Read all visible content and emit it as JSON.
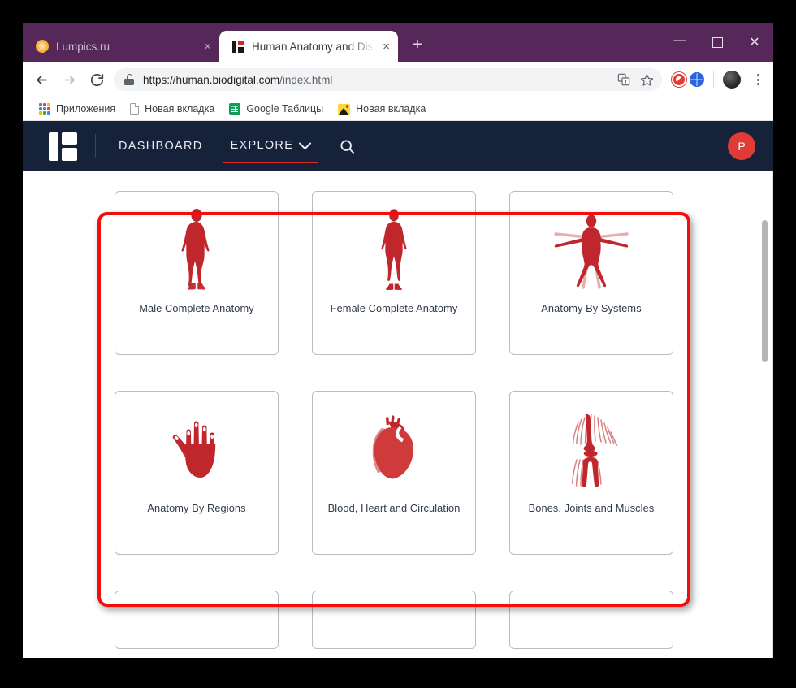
{
  "browser": {
    "tabs": [
      {
        "title": "Lumpics.ru",
        "favicon": "orange-slice-icon",
        "active": false,
        "close_label": "×"
      },
      {
        "title": "Human Anatomy and Disease in",
        "favicon": "biodigital-favicon",
        "active": true,
        "close_label": "×"
      }
    ],
    "new_tab_label": "+",
    "window_controls": {
      "minimize": "—",
      "maximize": "",
      "close": "✕"
    },
    "toolbar": {
      "back_label": "Back",
      "forward_label": "Forward",
      "reload_label": "Reload",
      "url_main": "https://human.biodigital.com",
      "url_path": "/index.html",
      "lock_label": "secure-connection",
      "translate_label": "Translate this page",
      "bookmark_label": "Bookmark this tab",
      "extension_adblock": "adblock-extension",
      "extension_globe": "globe-extension",
      "profile_label": "Profile",
      "menu_label": "Customize and control Google Chrome"
    },
    "bookmarks": [
      {
        "label": "Приложения",
        "icon": "apps-grid-icon"
      },
      {
        "label": "Новая вкладка",
        "icon": "document-icon"
      },
      {
        "label": "Google Таблицы",
        "icon": "google-sheets-icon"
      },
      {
        "label": "Новая вкладка",
        "icon": "image-icon"
      }
    ]
  },
  "site": {
    "logo_label": "BioDigital Human",
    "nav": [
      {
        "label": "DASHBOARD",
        "active": false,
        "has_chevron": false
      },
      {
        "label": "EXPLORE",
        "active": true,
        "has_chevron": true
      }
    ],
    "search_label": "Search",
    "avatar_initial": "P",
    "cards": [
      {
        "label": "Male Complete Anatomy",
        "icon": "male-body-icon"
      },
      {
        "label": "Female Complete Anatomy",
        "icon": "female-body-icon"
      },
      {
        "label": "Anatomy By Systems",
        "icon": "vitruvian-figure-icon"
      },
      {
        "label": "Anatomy By Regions",
        "icon": "hand-icon"
      },
      {
        "label": "Blood, Heart and Circulation",
        "icon": "heart-icon"
      },
      {
        "label": "Bones, Joints and Muscles",
        "icon": "knee-joint-icon"
      }
    ],
    "scrollbar_label": "Vertical scrollbar"
  },
  "annotation": {
    "label": "red-highlight-box",
    "color": "#f40d0d"
  },
  "colors": {
    "titlebar": "#56285a",
    "site_header": "#16213a",
    "accent_red": "#e02b2b",
    "icon_red": "#c0272d",
    "avatar_red": "#e03b36",
    "card_border": "#b9bcc2"
  }
}
